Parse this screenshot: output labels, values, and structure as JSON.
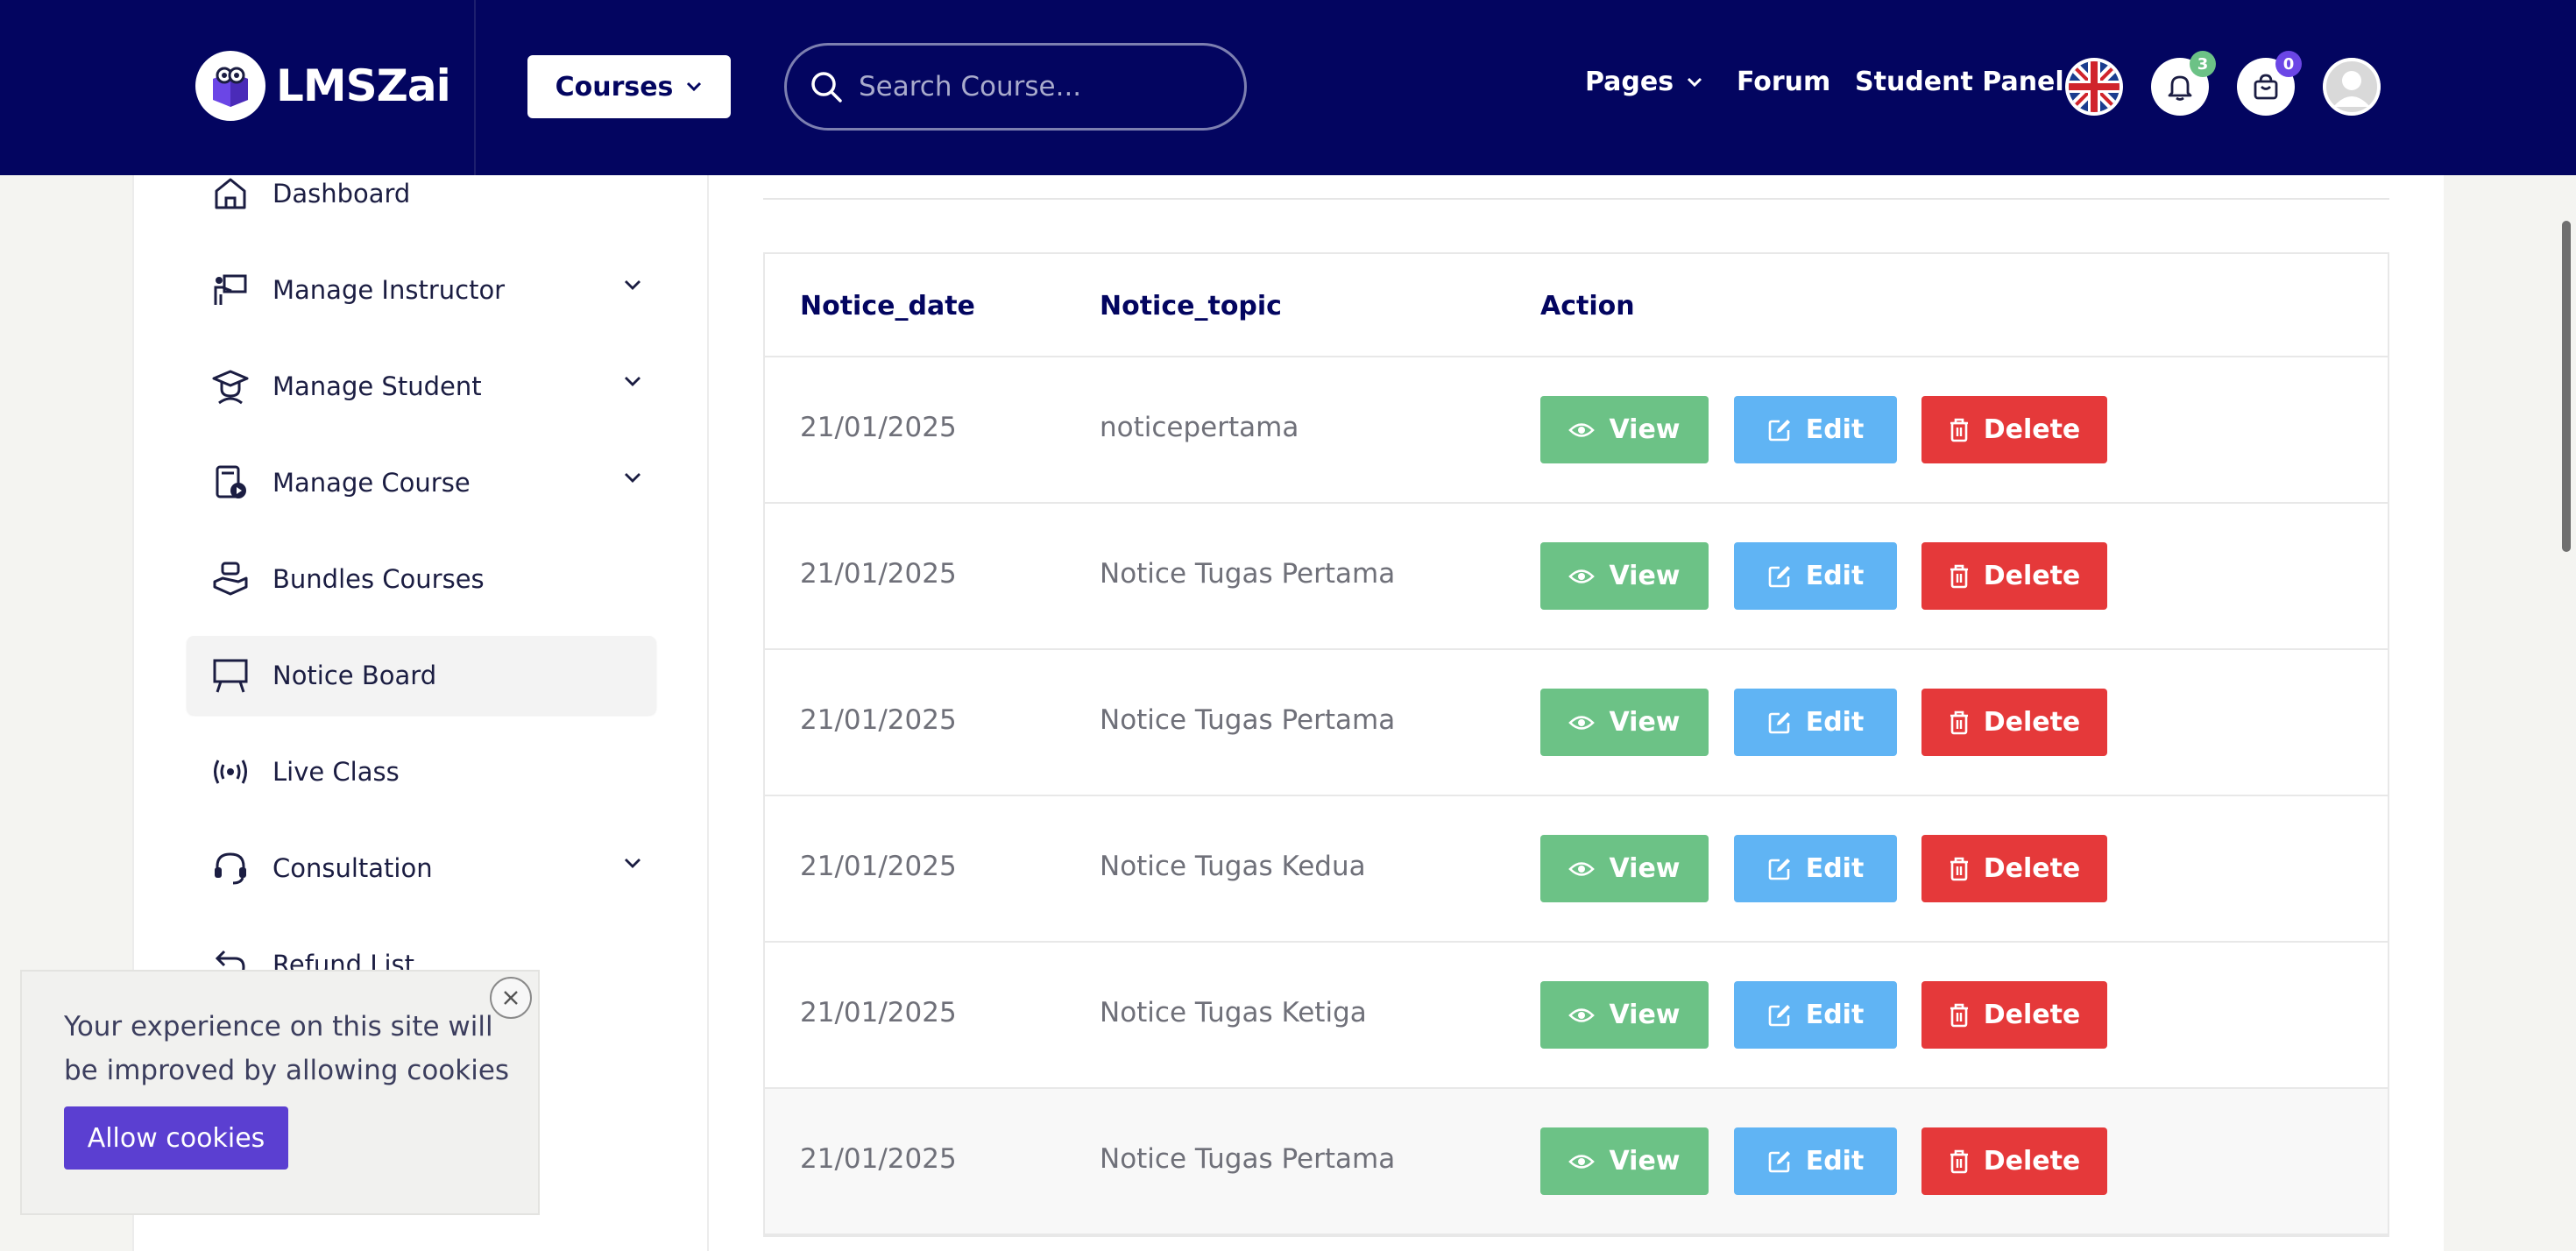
{
  "header": {
    "logo_text": "LMSZai",
    "courses_label": "Courses",
    "search_placeholder": "Search Course...",
    "nav": {
      "pages": "Pages",
      "forum": "Forum",
      "student_panel": "Student Panel"
    },
    "notification_count": "3",
    "cart_count": "0",
    "colors": {
      "bar": "#030560",
      "notif_badge": "#6cc286",
      "cart_badge": "#6b46e6"
    }
  },
  "sidebar": {
    "items": [
      {
        "label": "Dashboard",
        "icon": "home-icon",
        "expandable": false
      },
      {
        "label": "Manage Instructor",
        "icon": "instructor-icon",
        "expandable": true
      },
      {
        "label": "Manage Student",
        "icon": "graduate-icon",
        "expandable": true
      },
      {
        "label": "Manage Course",
        "icon": "course-icon",
        "expandable": true
      },
      {
        "label": "Bundles Courses",
        "icon": "bundle-icon",
        "expandable": false
      },
      {
        "label": "Notice Board",
        "icon": "board-icon",
        "expandable": false,
        "active": true
      },
      {
        "label": "Live Class",
        "icon": "broadcast-icon",
        "expandable": false
      },
      {
        "label": "Consultation",
        "icon": "headset-icon",
        "expandable": true
      },
      {
        "label": "Refund List",
        "icon": "refund-icon",
        "expandable": false
      }
    ]
  },
  "table": {
    "columns": [
      "Notice_date",
      "Notice_topic",
      "Action"
    ],
    "actions": {
      "view": "View",
      "edit": "Edit",
      "delete": "Delete"
    },
    "rows": [
      {
        "date": "21/01/2025",
        "topic": "noticepertama"
      },
      {
        "date": "21/01/2025",
        "topic": "Notice Tugas Pertama"
      },
      {
        "date": "21/01/2025",
        "topic": "Notice Tugas Pertama"
      },
      {
        "date": "21/01/2025",
        "topic": "Notice Tugas Kedua"
      },
      {
        "date": "21/01/2025",
        "topic": "Notice Tugas Ketiga"
      },
      {
        "date": "21/01/2025",
        "topic": "Notice Tugas Pertama"
      }
    ],
    "colors": {
      "view": "#6cc286",
      "edit": "#60b4f4",
      "delete": "#e5393a"
    }
  },
  "cookie": {
    "message": "Your experience on this site will be improved by allowing cookies",
    "button": "Allow cookies"
  }
}
